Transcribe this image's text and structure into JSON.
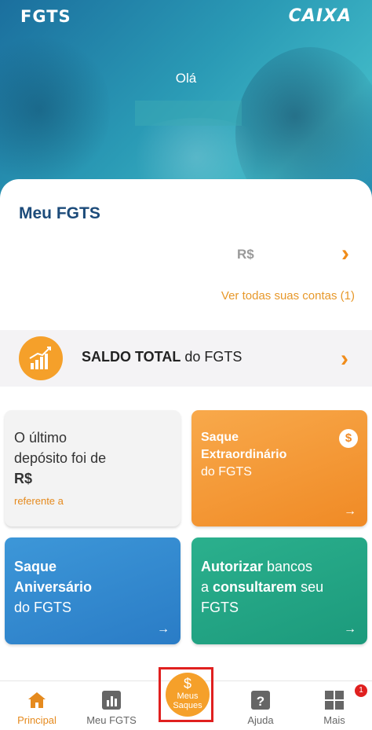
{
  "header": {
    "left_logo": "FGTS",
    "right_logo": "CAIXA",
    "greeting": "Olá"
  },
  "account": {
    "title": "Meu FGTS",
    "currency": "R$",
    "see_all": "Ver todas suas contas (1)"
  },
  "saldo": {
    "bold": "SALDO TOTAL",
    "rest": " do FGTS"
  },
  "tiles": {
    "last_deposit": {
      "line1": "O último",
      "line2": "depósito foi de",
      "currency": "R$",
      "sub": "referente a"
    },
    "extraordinario": {
      "line1": "Saque",
      "line2": "Extraordinário",
      "line3": "do FGTS",
      "badge": "$",
      "arrow": "→"
    },
    "aniversario": {
      "line1": "Saque",
      "line2": "Aniversário",
      "line3": "do FGTS",
      "arrow": "→"
    },
    "autorizar": {
      "b1": "Autorizar",
      "t1": " bancos",
      "t2": "a ",
      "b2": "consultarem",
      "t3": " seu",
      "t4": "FGTS",
      "arrow": "→"
    }
  },
  "nav": {
    "principal": "Principal",
    "meu_fgts": "Meu FGTS",
    "meus_saques_symbol": "$",
    "meus_saques_line1": "Meus",
    "meus_saques_line2": "Saques",
    "ajuda": "Ajuda",
    "mais": "Mais",
    "mais_badge": "1"
  },
  "colors": {
    "accent": "#f08c1a",
    "title": "#1c4b7a",
    "blue_tile": "#2a7cc6",
    "green_tile": "#1c9a7c",
    "highlight": "#e0201f"
  }
}
